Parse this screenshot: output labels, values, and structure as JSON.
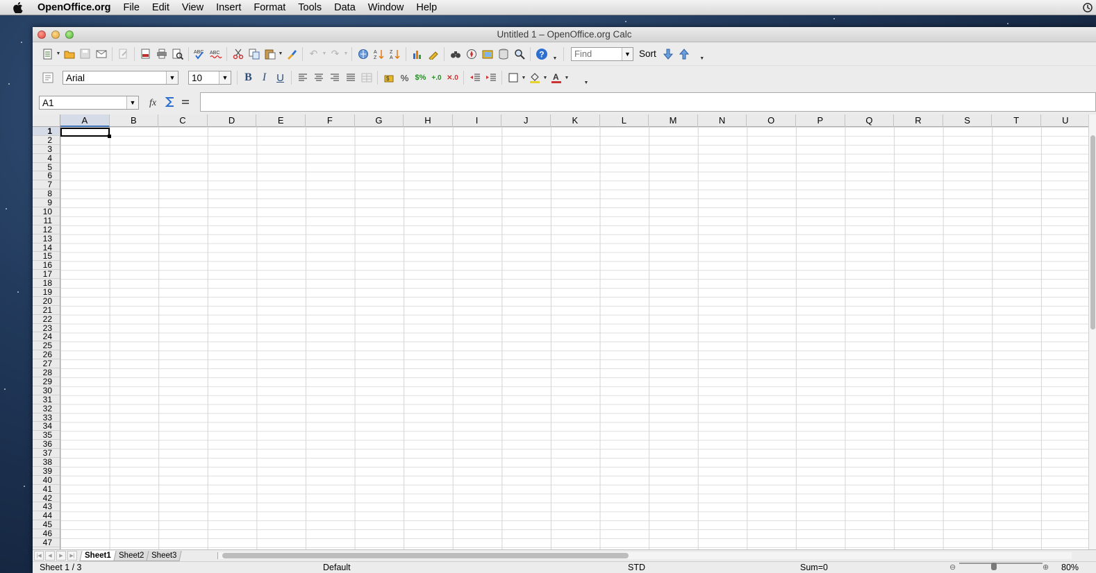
{
  "menubar": {
    "app_name": "OpenOffice.org",
    "items": [
      "File",
      "Edit",
      "View",
      "Insert",
      "Format",
      "Tools",
      "Data",
      "Window",
      "Help"
    ]
  },
  "window": {
    "title": "Untitled 1 – OpenOffice.org Calc"
  },
  "toolbar1": {
    "find_placeholder": "Find",
    "sort_label": "Sort"
  },
  "toolbar2": {
    "font_name": "Arial",
    "font_size": "10"
  },
  "formula_bar": {
    "name_box": "A1",
    "formula_value": ""
  },
  "grid": {
    "columns": [
      "A",
      "B",
      "C",
      "D",
      "E",
      "F",
      "G",
      "H",
      "I",
      "J",
      "K",
      "L",
      "M",
      "N",
      "O",
      "P",
      "Q",
      "R",
      "S",
      "T",
      "U"
    ],
    "rows": [
      "1",
      "2",
      "3",
      "4",
      "5",
      "6",
      "7",
      "8",
      "9",
      "10",
      "11",
      "12",
      "13",
      "14",
      "15",
      "16",
      "17",
      "18",
      "19",
      "20",
      "21",
      "22",
      "23",
      "24",
      "25",
      "26",
      "27",
      "28",
      "29",
      "30",
      "31",
      "32",
      "33",
      "34",
      "35",
      "36",
      "37",
      "38",
      "39",
      "40",
      "41",
      "42",
      "43",
      "44",
      "45",
      "46",
      "47"
    ],
    "active_cell": "A1"
  },
  "sheets": {
    "tabs": [
      "Sheet1",
      "Sheet2",
      "Sheet3"
    ],
    "active": "Sheet1"
  },
  "statusbar": {
    "sheet_position": "Sheet 1 / 3",
    "page_style": "Default",
    "selection_mode": "STD",
    "sum": "Sum=0",
    "zoom": "80%"
  },
  "colors": {
    "selection_header": "#d6dce7",
    "icon_blue": "#2f4f7a",
    "desktop": "#223a5c"
  }
}
